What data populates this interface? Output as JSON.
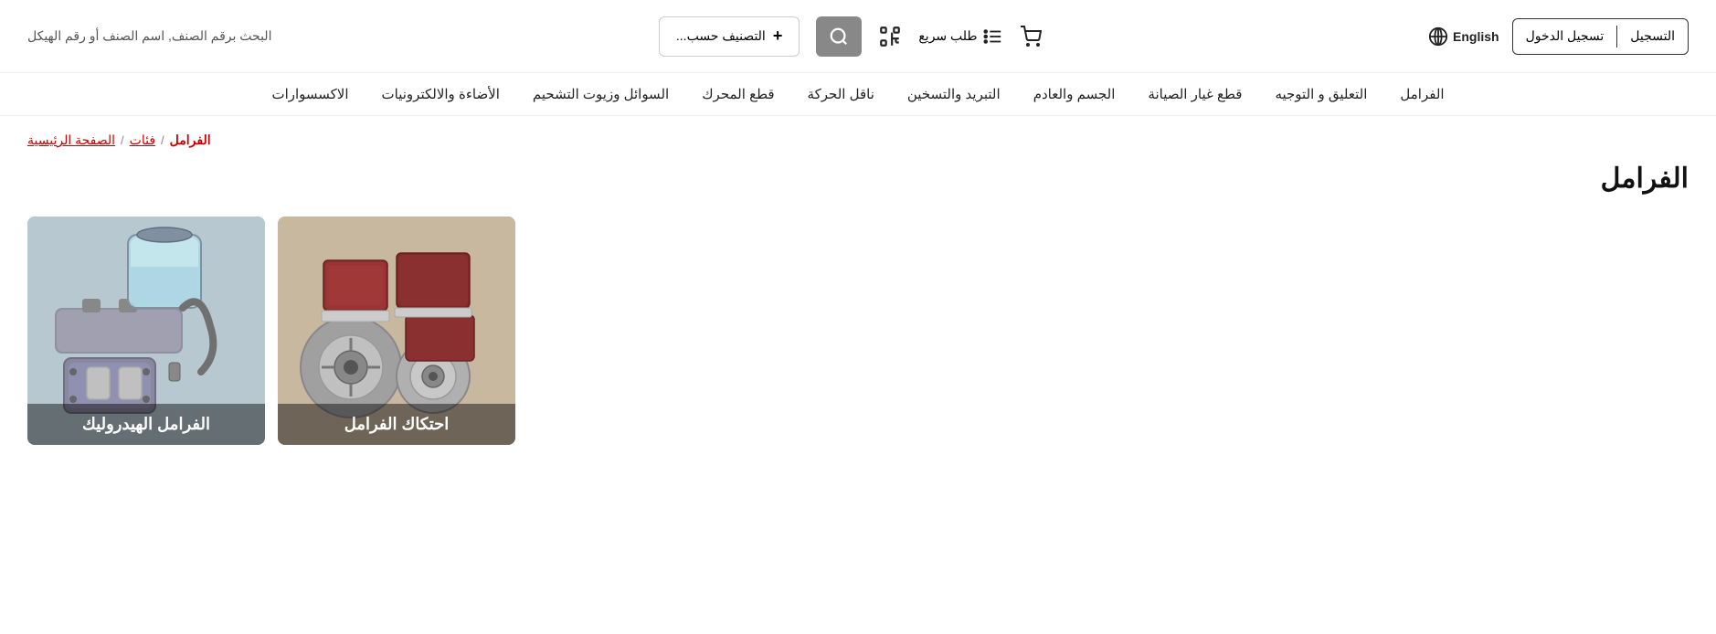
{
  "header": {
    "search_placeholder": "البحث برقم الصنف, اسم الصنف أو رقم الهيكل",
    "login_label": "التسجيل",
    "register_label": "تسجيل الدخول",
    "language_label": "English",
    "filter_label": "التصنيف حسب...",
    "filter_plus": "+",
    "quick_order_label": "طلب سريع",
    "cart_icon": "cart-icon",
    "scan_icon": "scan-icon",
    "list_icon": "list-icon",
    "globe_icon": "globe-icon",
    "search_icon": "search-icon"
  },
  "nav": {
    "items": [
      {
        "label": "الفرامل"
      },
      {
        "label": "التعليق و التوجيه"
      },
      {
        "label": "قطع غيار الصيانة"
      },
      {
        "label": "الجسم والعادم"
      },
      {
        "label": "التبريد والتسخين"
      },
      {
        "label": "ناقل الحركة"
      },
      {
        "label": "قطع المحرك"
      },
      {
        "label": "السوائل وزيوت التشحيم"
      },
      {
        "label": "الأضاءة والالكترونيات"
      },
      {
        "label": "الاكسسوارات"
      }
    ]
  },
  "breadcrumb": {
    "home_label": "الصفحة الرئيسية",
    "separator1": "/",
    "categories_label": "فئات",
    "separator2": "/",
    "current_label": "الفرامل"
  },
  "page": {
    "title": "الفرامل"
  },
  "cards": [
    {
      "id": "brake-friction",
      "label": "احتكاك الفرامل"
    },
    {
      "id": "brake-hydraulic",
      "label": "الفرامل الهيدروليك"
    }
  ]
}
